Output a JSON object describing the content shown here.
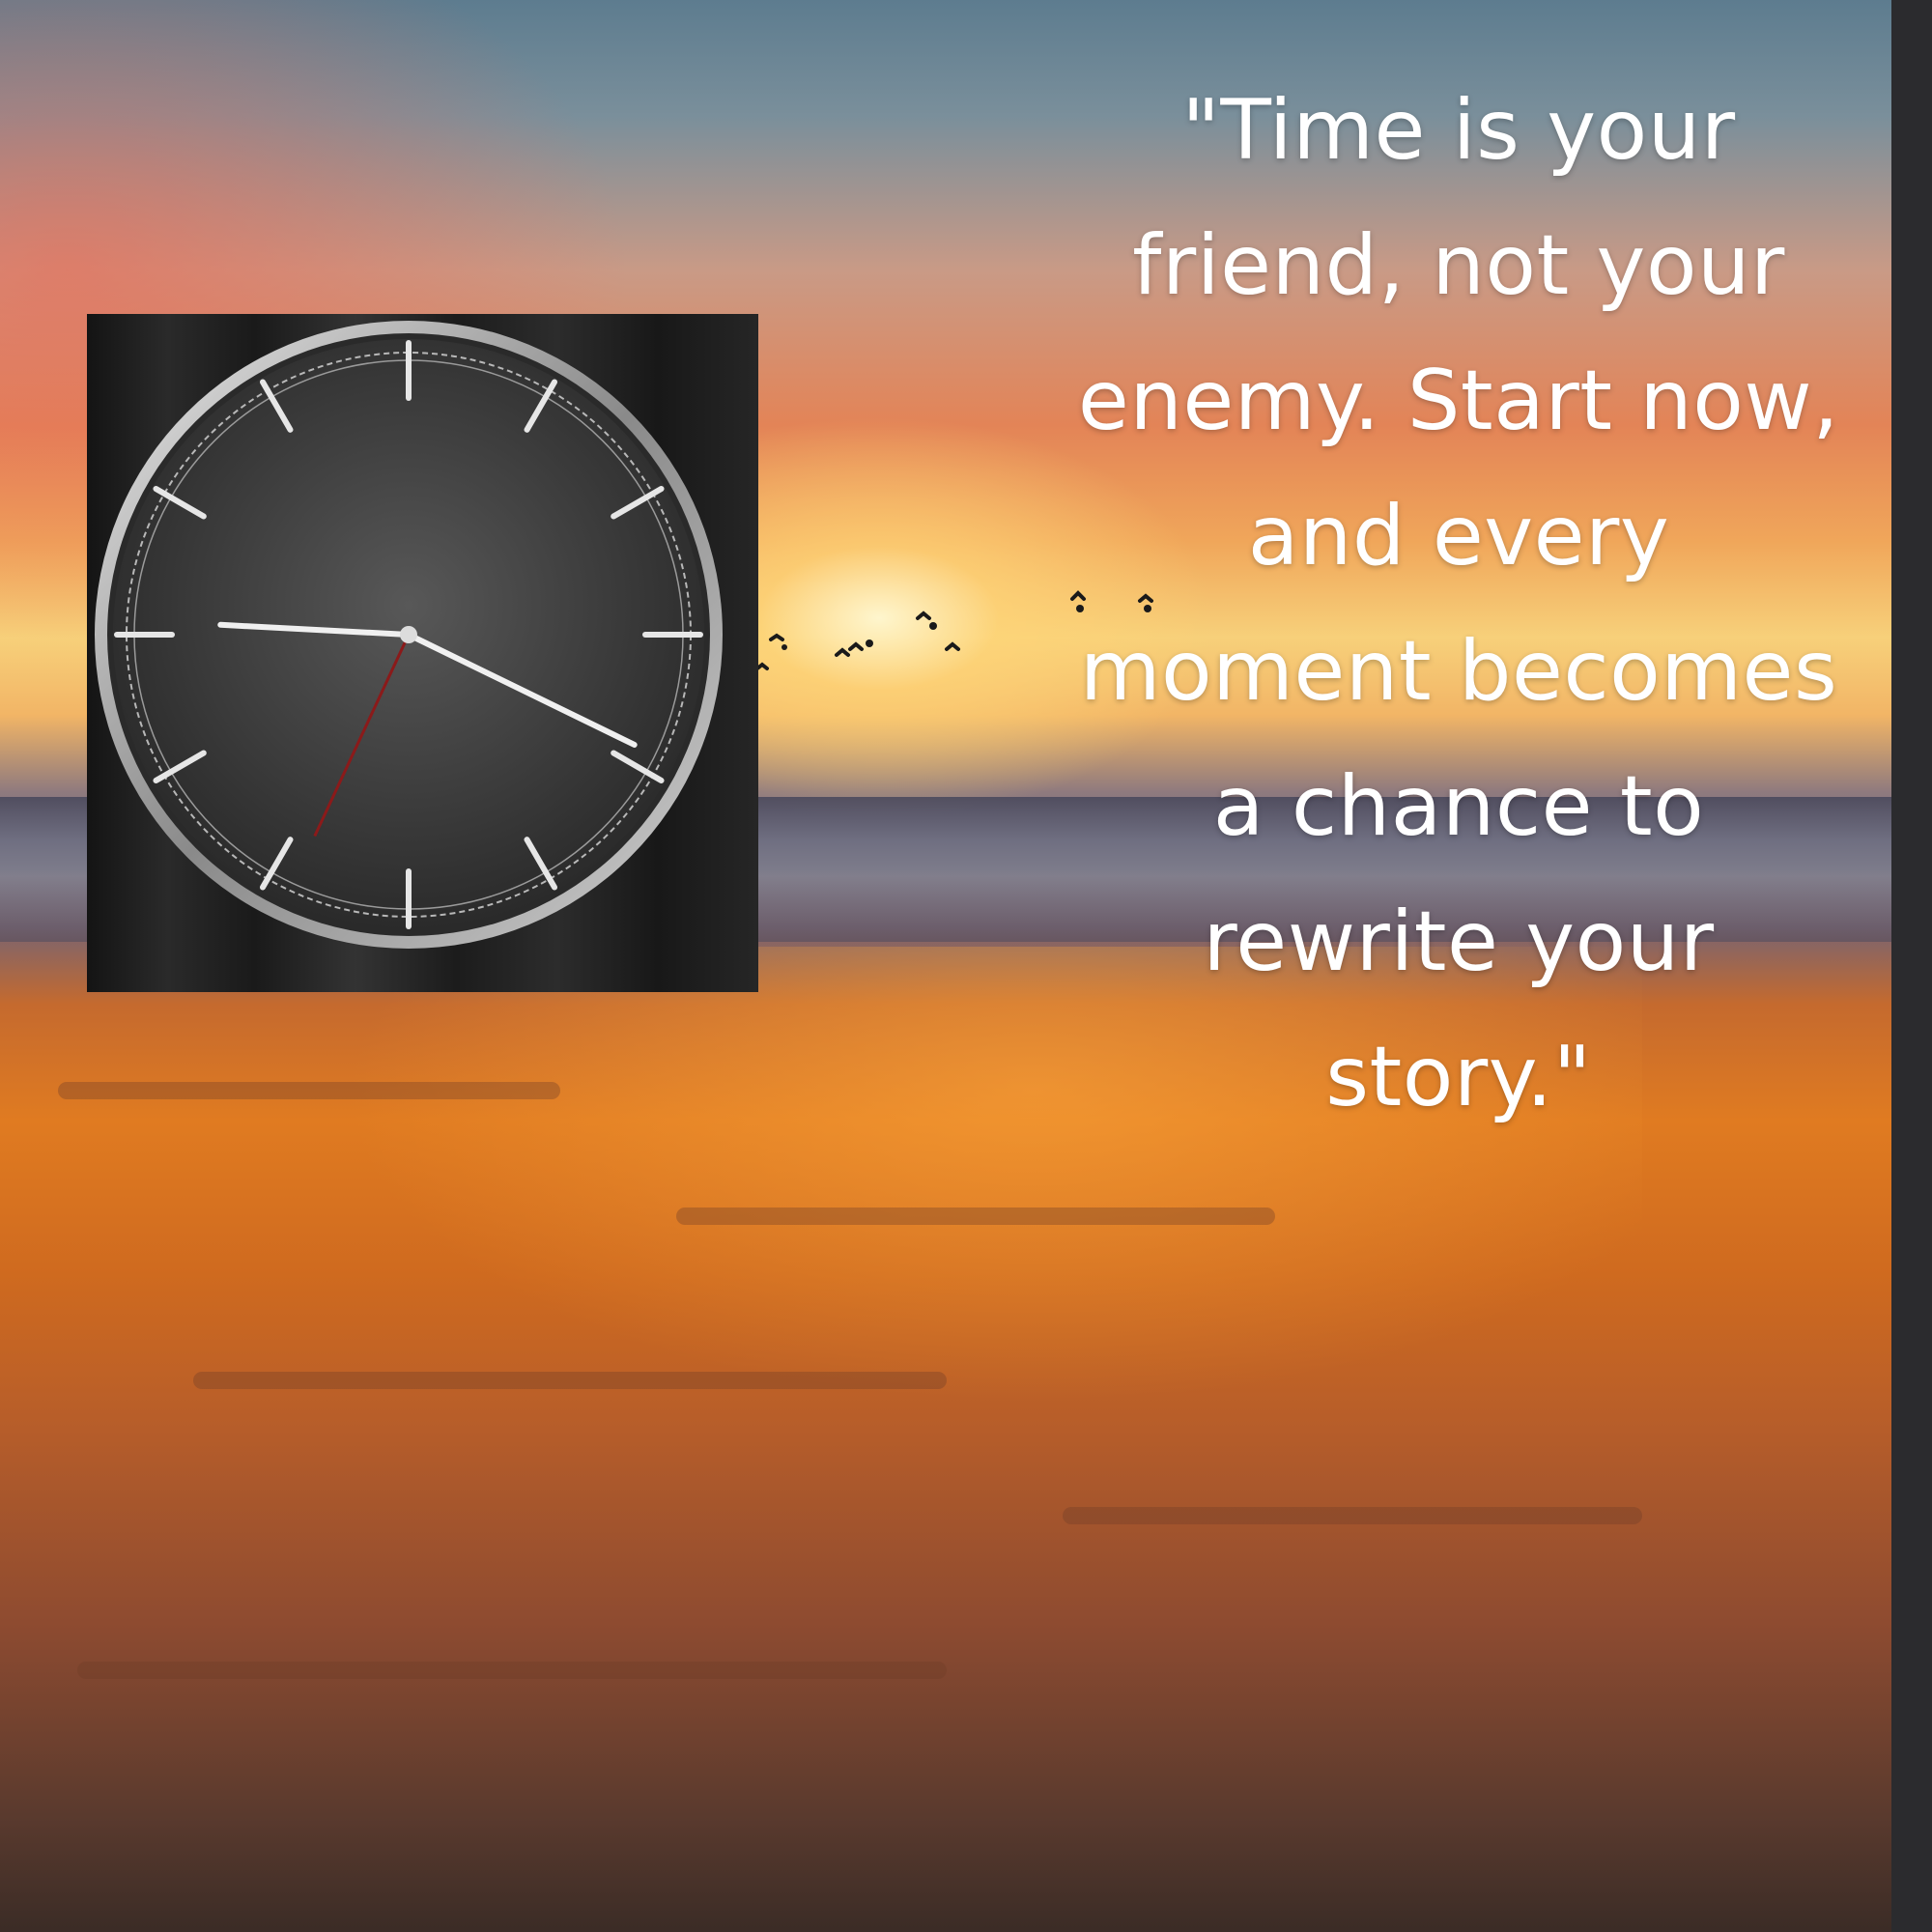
{
  "quote": {
    "lines": [
      "\"Time is your",
      "friend, not your",
      "enemy. Start now,",
      "and every",
      "moment becomes",
      "a chance to",
      "rewrite your",
      "story.\""
    ]
  },
  "colors": {
    "quote_text": "#ffffff",
    "sidebar": "#2b2b2e",
    "clock_face": "#3a3a3a",
    "second_hand": "#8b1a1a"
  },
  "icons": {
    "clock": "analog-clock-icon",
    "birds": "flying-birds-icon"
  }
}
